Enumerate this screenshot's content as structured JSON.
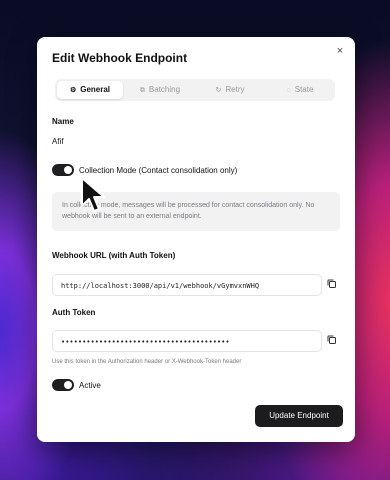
{
  "modal": {
    "title": "Edit Webhook Endpoint",
    "close_icon": "×"
  },
  "tabs": [
    {
      "label": "General",
      "icon": "⚙",
      "active": true
    },
    {
      "label": "Batching",
      "icon": "⧉",
      "active": false
    },
    {
      "label": "Retry",
      "icon": "↻",
      "active": false
    },
    {
      "label": "State",
      "icon": "◌",
      "active": false
    }
  ],
  "name": {
    "label": "Name",
    "value": "Afif"
  },
  "collection_mode": {
    "label": "Collection Mode (Contact consolidation only)",
    "enabled": true,
    "info": "In collection mode, messages will be processed for contact consolidation only. No webhook will be sent to an external endpoint."
  },
  "webhook_url": {
    "label": "Webhook URL (with Auth Token)",
    "value": "http://localhost:3000/api/v1/webhook/vGymvxnWHQ"
  },
  "auth_token": {
    "label": "Auth Token",
    "value": "••••••••••••••••••••••••••••••••••••••••",
    "helper": "Use this token in the Authorization header or X-Webhook-Token header"
  },
  "active": {
    "label": "Active",
    "enabled": true
  },
  "footer": {
    "update_label": "Update Endpoint"
  }
}
